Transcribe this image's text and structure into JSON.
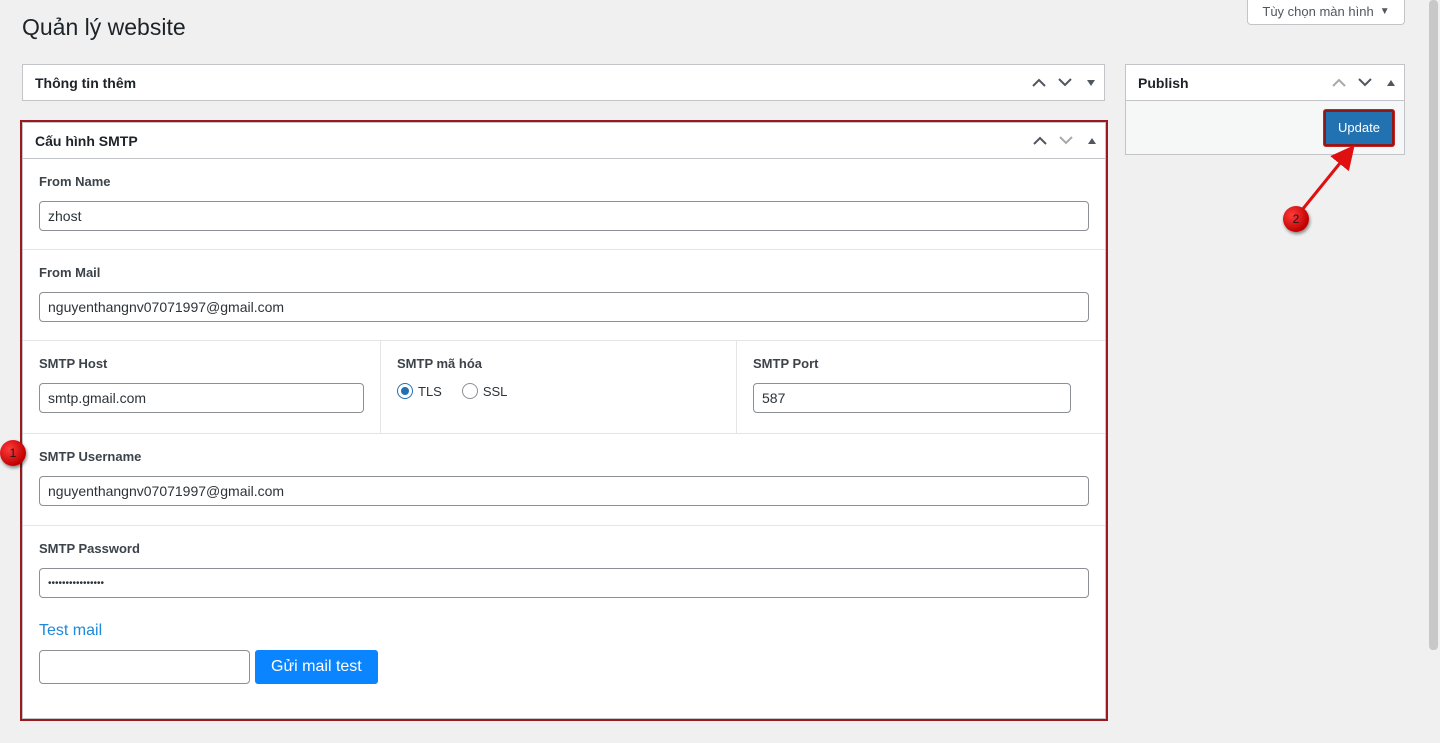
{
  "page": {
    "title": "Quản lý website"
  },
  "screen_options": {
    "label": "Tùy chọn màn hình"
  },
  "box_info": {
    "title": "Thông tin thêm"
  },
  "box_publish": {
    "title": "Publish",
    "update_label": "Update"
  },
  "box_smtp": {
    "title": "Cấu hình SMTP",
    "from_name": {
      "label": "From Name",
      "value": "zhost"
    },
    "from_mail": {
      "label": "From Mail",
      "value": "nguyenthangnv07071997@gmail.com"
    },
    "smtp_host": {
      "label": "SMTP Host",
      "value": "smtp.gmail.com"
    },
    "smtp_encryption": {
      "label": "SMTP mã hóa",
      "options": [
        "TLS",
        "SSL"
      ],
      "selected": "TLS"
    },
    "smtp_port": {
      "label": "SMTP Port",
      "value": "587"
    },
    "smtp_username": {
      "label": "SMTP Username",
      "value": "nguyenthangnv07071997@gmail.com"
    },
    "smtp_password": {
      "label": "SMTP Password",
      "value": "••••••••••••••••"
    },
    "test_mail": {
      "title": "Test mail",
      "input_value": "",
      "button_label": "Gửi mail test"
    }
  },
  "annotations": {
    "marker_1": "1",
    "marker_2": "2"
  },
  "colors": {
    "accent": "#2271b1",
    "test_button": "#0a84ff",
    "annotation_red": "#cc0000"
  }
}
